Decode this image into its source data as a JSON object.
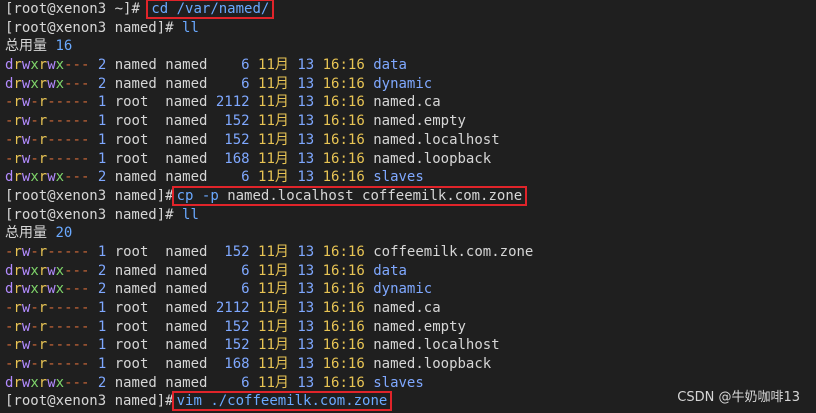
{
  "prompts": {
    "home": "[root@xenon3 ~]",
    "named": "[root@xenon3 named]"
  },
  "cmd1": {
    "text": "cd /var/named/"
  },
  "cmd2": {
    "text": "ll"
  },
  "total1": {
    "label": "总用量",
    "value": "16"
  },
  "listing1": [
    {
      "perm": "drwxrwx---",
      "links": "2",
      "owner": "named",
      "group": "named",
      "size": "6",
      "month": "11月",
      "day": "13",
      "time": "16:16",
      "name": "data",
      "dir": true
    },
    {
      "perm": "drwxrwx---",
      "links": "2",
      "owner": "named",
      "group": "named",
      "size": "6",
      "month": "11月",
      "day": "13",
      "time": "16:16",
      "name": "dynamic",
      "dir": true
    },
    {
      "perm": "-rw-r-----",
      "links": "1",
      "owner": "root",
      "group": "named",
      "size": "2112",
      "month": "11月",
      "day": "13",
      "time": "16:16",
      "name": "named.ca",
      "dir": false
    },
    {
      "perm": "-rw-r-----",
      "links": "1",
      "owner": "root",
      "group": "named",
      "size": "152",
      "month": "11月",
      "day": "13",
      "time": "16:16",
      "name": "named.empty",
      "dir": false
    },
    {
      "perm": "-rw-r-----",
      "links": "1",
      "owner": "root",
      "group": "named",
      "size": "152",
      "month": "11月",
      "day": "13",
      "time": "16:16",
      "name": "named.localhost",
      "dir": false
    },
    {
      "perm": "-rw-r-----",
      "links": "1",
      "owner": "root",
      "group": "named",
      "size": "168",
      "month": "11月",
      "day": "13",
      "time": "16:16",
      "name": "named.loopback",
      "dir": false
    },
    {
      "perm": "drwxrwx---",
      "links": "2",
      "owner": "named",
      "group": "named",
      "size": "6",
      "month": "11月",
      "day": "13",
      "time": "16:16",
      "name": "slaves",
      "dir": true
    }
  ],
  "cmd3": {
    "cmd": "cp",
    "flag": "-p",
    "args": "named.localhost coffeemilk.com.zone"
  },
  "cmd4": {
    "text": "ll"
  },
  "total2": {
    "label": "总用量",
    "value": "20"
  },
  "listing2": [
    {
      "perm": "-rw-r-----",
      "links": "1",
      "owner": "root",
      "group": "named",
      "size": "152",
      "month": "11月",
      "day": "13",
      "time": "16:16",
      "name": "coffeemilk.com.zone",
      "dir": false
    },
    {
      "perm": "drwxrwx---",
      "links": "2",
      "owner": "named",
      "group": "named",
      "size": "6",
      "month": "11月",
      "day": "13",
      "time": "16:16",
      "name": "data",
      "dir": true
    },
    {
      "perm": "drwxrwx---",
      "links": "2",
      "owner": "named",
      "group": "named",
      "size": "6",
      "month": "11月",
      "day": "13",
      "time": "16:16",
      "name": "dynamic",
      "dir": true
    },
    {
      "perm": "-rw-r-----",
      "links": "1",
      "owner": "root",
      "group": "named",
      "size": "2112",
      "month": "11月",
      "day": "13",
      "time": "16:16",
      "name": "named.ca",
      "dir": false
    },
    {
      "perm": "-rw-r-----",
      "links": "1",
      "owner": "root",
      "group": "named",
      "size": "152",
      "month": "11月",
      "day": "13",
      "time": "16:16",
      "name": "named.empty",
      "dir": false
    },
    {
      "perm": "-rw-r-----",
      "links": "1",
      "owner": "root",
      "group": "named",
      "size": "152",
      "month": "11月",
      "day": "13",
      "time": "16:16",
      "name": "named.localhost",
      "dir": false
    },
    {
      "perm": "-rw-r-----",
      "links": "1",
      "owner": "root",
      "group": "named",
      "size": "168",
      "month": "11月",
      "day": "13",
      "time": "16:16",
      "name": "named.loopback",
      "dir": false
    },
    {
      "perm": "drwxrwx---",
      "links": "2",
      "owner": "named",
      "group": "named",
      "size": "6",
      "month": "11月",
      "day": "13",
      "time": "16:16",
      "name": "slaves",
      "dir": true
    }
  ],
  "cmd5": {
    "cmd": "vim",
    "args": "./coffeemilk.com.zone"
  },
  "watermark": "CSDN @牛奶咖啡13",
  "colors": {
    "background": "#1f1f1f",
    "highlight_box": "#e0242a",
    "directory": "#7fa8ff",
    "time": "#e8c454"
  }
}
